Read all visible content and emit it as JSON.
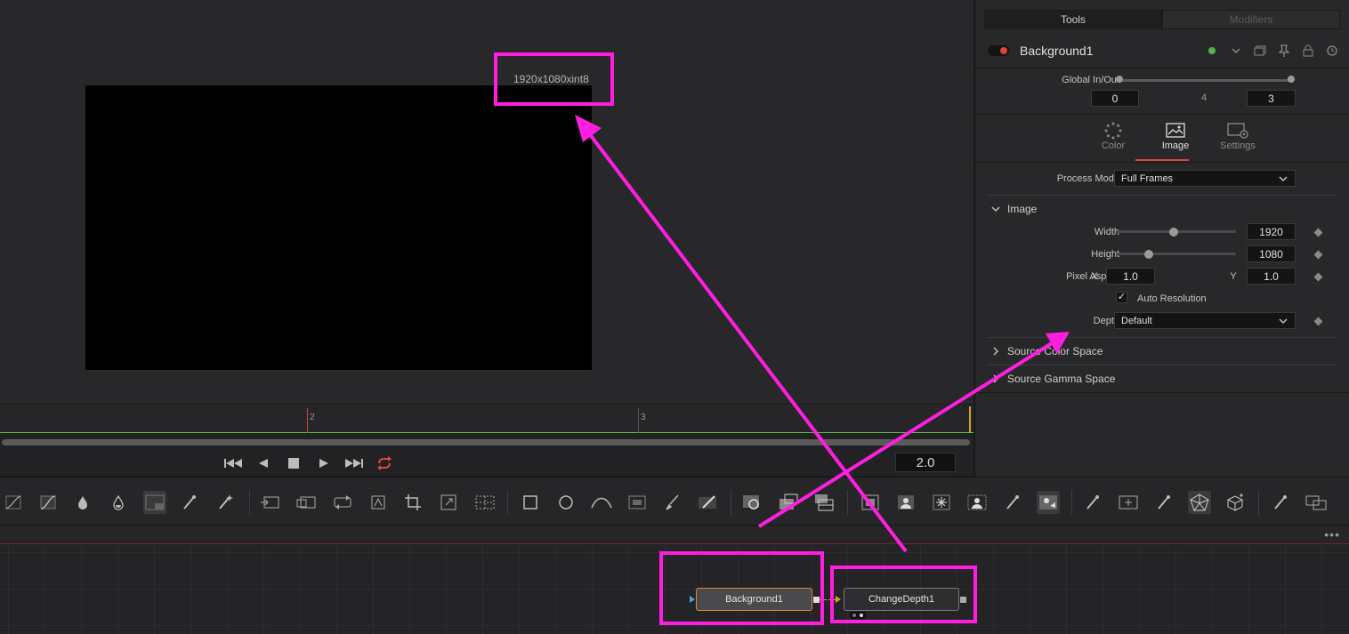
{
  "viewer": {
    "resolution_label": "1920x1080xint8"
  },
  "timeline": {
    "ticks": [
      "2",
      "3"
    ],
    "current_frame": "2.0"
  },
  "inspector": {
    "tabs": {
      "tools": "Tools",
      "modifiers": "Modifiers"
    },
    "node_name": "Background1",
    "global_inout": {
      "label": "Global In/Out",
      "in": "0",
      "mid": "4",
      "out": "3"
    },
    "mode_tabs": {
      "color": "Color",
      "image": "Image",
      "settings": "Settings"
    },
    "process_mode": {
      "label": "Process Mode",
      "value": "Full Frames"
    },
    "image_section": {
      "title": "Image",
      "width": {
        "label": "Width",
        "value": "1920"
      },
      "height": {
        "label": "Height",
        "value": "1080"
      },
      "pixel_aspect": {
        "label": "Pixel Aspect",
        "x_label": "X",
        "x": "1.0",
        "y_label": "Y",
        "y": "1.0"
      },
      "auto_resolution": {
        "label": "Auto Resolution",
        "checked": true
      },
      "depth": {
        "label": "Depth",
        "value": "Default"
      }
    },
    "source_color_space": "Source Color Space",
    "source_gamma_space": "Source Gamma Space"
  },
  "node_editor": {
    "more": "•••",
    "nodes": [
      {
        "name": "Background1"
      },
      {
        "name": "ChangeDepth1"
      }
    ]
  },
  "colors": {
    "annotation": "#ff1ee0",
    "accent_red": "#d6443d",
    "selected_orange": "#d98a3a",
    "green": "#56b14a"
  }
}
